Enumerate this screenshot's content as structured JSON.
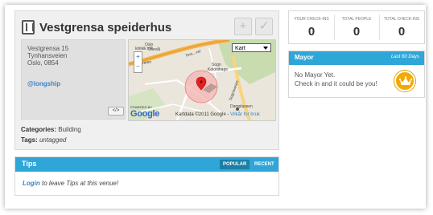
{
  "venue": {
    "name": "Vestgrensa speiderhus",
    "address_lines": [
      "Vestgrensa 15",
      "Tynhansveien",
      "Oslo, 0854"
    ],
    "twitter_handle": "@longship",
    "embed_label": "</>",
    "add_icon": "plus-icon",
    "check_icon": "checkmark-icon",
    "categories_label": "Categories:",
    "categories_value": "Building",
    "tags_label": "Tags:",
    "tags_value": "untagged"
  },
  "map": {
    "type_selector": "Kart",
    "attribution": "Kartdata ©2011 Google - ",
    "attribution_link": "Vilkår for bruk",
    "powered_by": "POWERED BY",
    "google_logo": "Google",
    "zoom_in": "+",
    "zoom_out": "−",
    "place_labels": [
      "Oslo",
      "Ullevål",
      "Sogn",
      "Kolonihage",
      "Damplassen",
      "Tors...vei",
      "Ringveien",
      "Sognsveien",
      "klinikk HF"
    ],
    "colors": {
      "road_major": "#f3b14a",
      "road_minor": "#ffffff",
      "green": "#c8dcb0",
      "radius_circle": "#f4b3b3",
      "marker": "#e2231a"
    }
  },
  "tips": {
    "title": "Tips",
    "tab_popular": "POPULAR",
    "tab_recent": "RECENT",
    "login_link": "Login",
    "body_text": " to leave Tips at this venue!"
  },
  "stats": [
    {
      "label": "YOUR CHECK-INS",
      "value": "0"
    },
    {
      "label": "TOTAL PEOPLE",
      "value": "0"
    },
    {
      "label": "TOTAL CHECK-INS",
      "value": "0"
    }
  ],
  "mayor": {
    "title": "Mayor",
    "period": "Last 60 Days",
    "line1": "No Mayor Yet.",
    "line2": "Check in and it could be you!",
    "badge_icon": "crown-icon"
  },
  "colors": {
    "accent_blue": "#2ea7d8",
    "link_blue": "#3a84c4",
    "crown_gold": "#f2a900"
  }
}
